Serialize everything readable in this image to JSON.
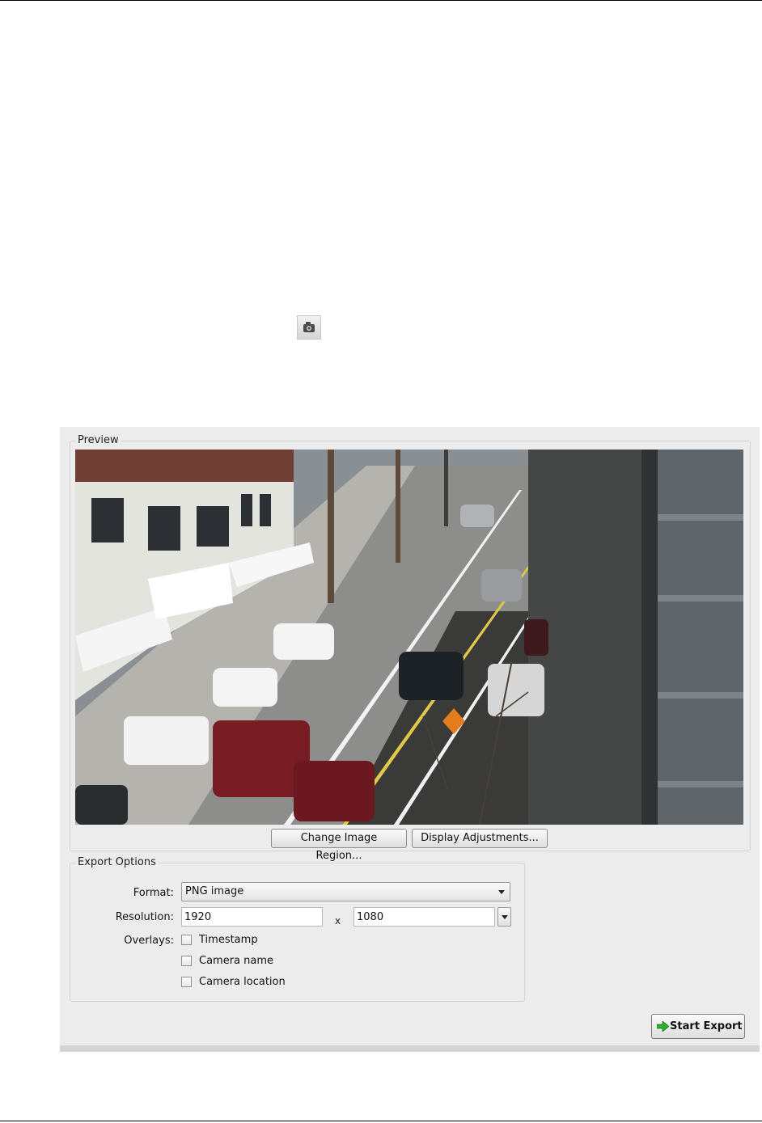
{
  "dialog": {
    "preview": {
      "title": "Preview",
      "change_region_label": "Change Image Region...",
      "display_adjustments_label": "Display Adjustments..."
    },
    "export_options": {
      "title": "Export Options",
      "format_label": "Format:",
      "format_value": "PNG image",
      "resolution_label": "Resolution:",
      "width_value": "1920",
      "times_sign": "x",
      "height_value": "1080",
      "overlays_label": "Overlays:",
      "overlays": [
        {
          "label": "Timestamp",
          "checked": false
        },
        {
          "label": "Camera name",
          "checked": false
        },
        {
          "label": "Camera location",
          "checked": false
        }
      ]
    },
    "start_export_label": "Start Export"
  },
  "icons": {
    "snapshot": "camera-icon",
    "start_export": "green-arrow-icon"
  },
  "colors": {
    "dialog_bg": "#ececec",
    "arrow_green": "#2fae2f"
  }
}
